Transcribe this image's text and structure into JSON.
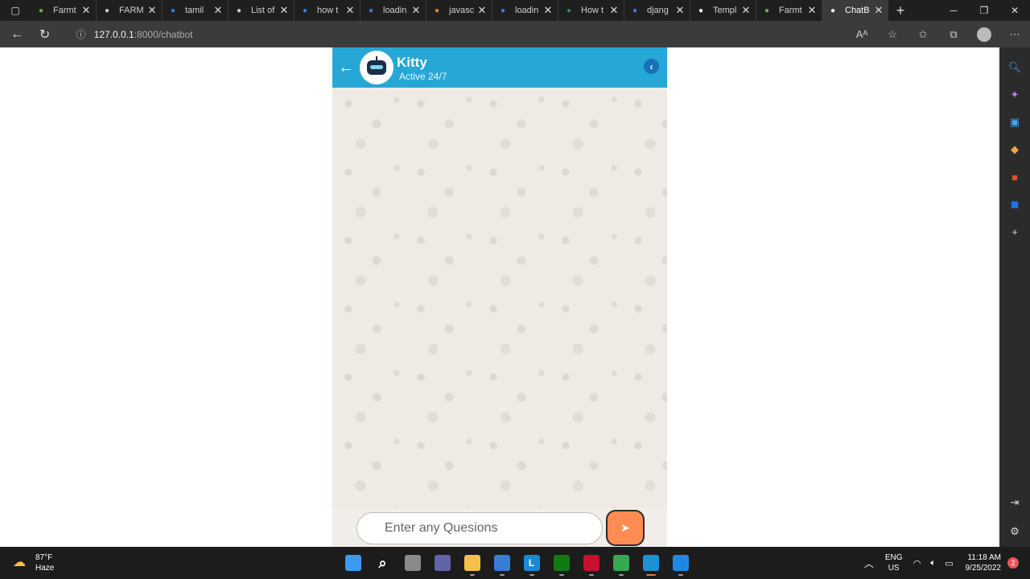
{
  "browser": {
    "tabs": [
      {
        "title": "Farmt",
        "icon": "sprout-icon",
        "color": "#6ab04c"
      },
      {
        "title": "FARM",
        "icon": "page-icon",
        "color": "#cccccc"
      },
      {
        "title": "tamil",
        "icon": "search-icon",
        "color": "#3b7ddd"
      },
      {
        "title": "List of",
        "icon": "wikipedia-icon",
        "color": "#cccccc"
      },
      {
        "title": "how t",
        "icon": "search-icon",
        "color": "#3b7ddd"
      },
      {
        "title": "loadin",
        "icon": "search-icon",
        "color": "#3b7ddd"
      },
      {
        "title": "javasc",
        "icon": "stackoverflow-icon",
        "color": "#f48024"
      },
      {
        "title": "loadin",
        "icon": "search-icon",
        "color": "#3b7ddd"
      },
      {
        "title": "How t",
        "icon": "geeks-icon",
        "color": "#2f8d46"
      },
      {
        "title": "djang",
        "icon": "search-icon",
        "color": "#3b7ddd"
      },
      {
        "title": "Templ",
        "icon": "django-icon",
        "color": "#ffffff"
      },
      {
        "title": "Farmt",
        "icon": "sprout-icon",
        "color": "#6ab04c"
      },
      {
        "title": "ChatB",
        "icon": "page-icon",
        "color": "#ffffff",
        "active": true
      }
    ],
    "url_host": "127.0.0.1",
    "url_rest": ":8000/chatbot"
  },
  "chat": {
    "bot_name": "Kitty",
    "bot_status": "Active 24/7",
    "input_placeholder": "Enter any Quesions",
    "header_color": "#26a7d6",
    "send_color": "#ff8c52"
  },
  "taskbar": {
    "weather_temp": "87°F",
    "weather_desc": "Haze",
    "lang_line1": "ENG",
    "lang_line2": "US",
    "time": "11:18 AM",
    "date": "9/25/2022",
    "notifications": "2",
    "apps": [
      {
        "name": "start-icon",
        "color": "#3a9bf0"
      },
      {
        "name": "search-icon",
        "color": "transparent"
      },
      {
        "name": "task-view-icon",
        "color": "#8a8a8a"
      },
      {
        "name": "chat-icon",
        "color": "#6264a7"
      },
      {
        "name": "file-explorer-icon",
        "color": "#f5c04a"
      },
      {
        "name": "store-icon",
        "color": "#3a7bd5"
      },
      {
        "name": "l-app-icon",
        "color": "#1a8ad4",
        "letter": "L"
      },
      {
        "name": "xbox-icon",
        "color": "#107c10"
      },
      {
        "name": "mcafee-icon",
        "color": "#c8102e"
      },
      {
        "name": "chrome-icon",
        "color": "#34a853"
      },
      {
        "name": "edge-icon",
        "color": "#1f8fd8"
      },
      {
        "name": "vscode-icon",
        "color": "#1e88e5"
      }
    ]
  }
}
